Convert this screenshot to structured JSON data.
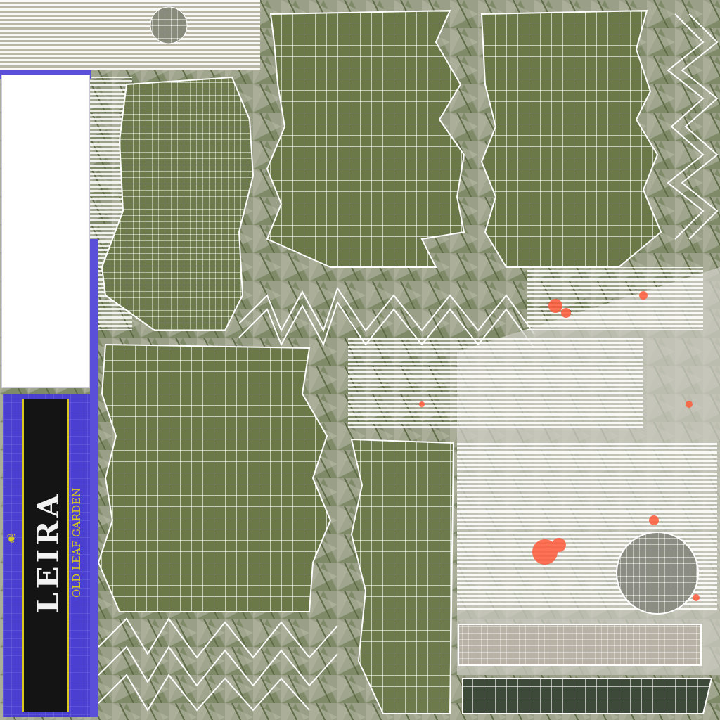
{
  "label": {
    "brand": "LEIRA",
    "subtitle": "OLD LEAF GARDEN"
  },
  "colors": {
    "leaf_green": "#6b7a4a",
    "wire": "#ffffff",
    "label_blue": "#4a3fd0",
    "label_black": "#141414",
    "label_gold": "#d8c820",
    "ash": "#cfcfc6",
    "ember": "#ff5a3a"
  },
  "icons": [
    "leaf-icon"
  ]
}
